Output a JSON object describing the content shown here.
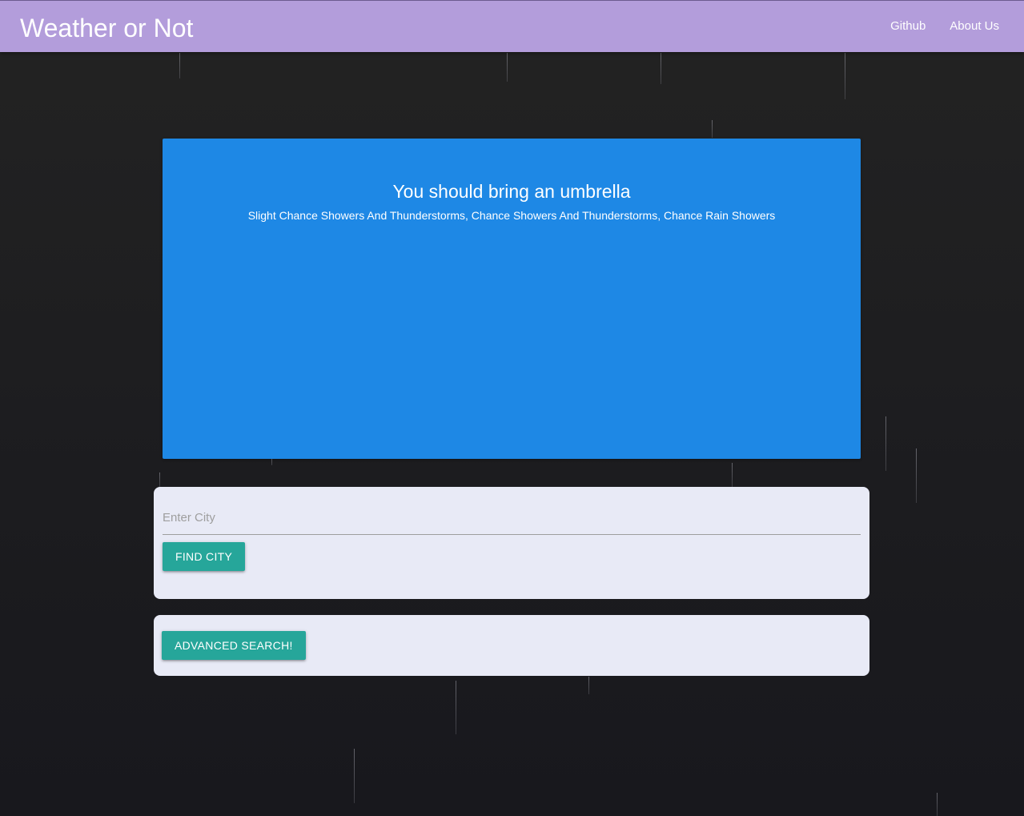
{
  "navbar": {
    "brand": "Weather or Not",
    "links": [
      {
        "label": "Github"
      },
      {
        "label": "About Us"
      }
    ]
  },
  "weather": {
    "headline": "You should bring an umbrella",
    "forecast": "Slight Chance Showers And Thunderstorms, Chance Showers And Thunderstorms, Chance Rain Showers"
  },
  "search": {
    "placeholder": "Enter City",
    "value": "",
    "find_button": "Find City"
  },
  "advanced": {
    "button": "Advanced Search!"
  },
  "colors": {
    "navbar": "#b39ddb",
    "card": "#1e88e5",
    "button": "#26a69a",
    "panel": "#e8eaf6",
    "background": "#1c1c1f"
  }
}
